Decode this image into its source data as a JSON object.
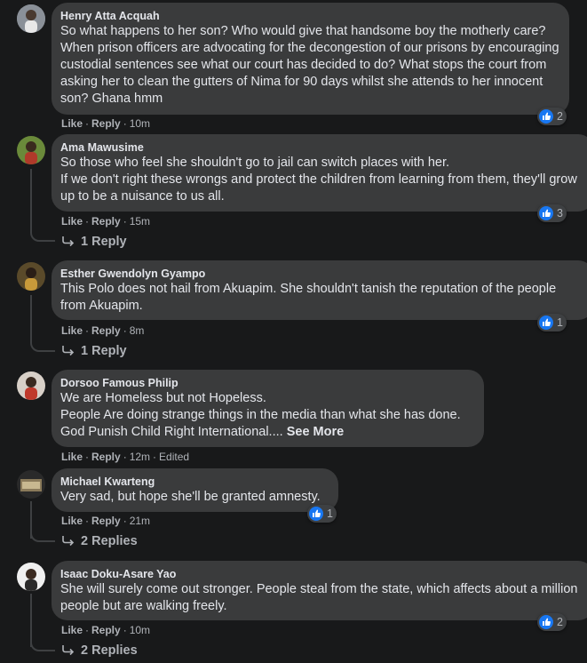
{
  "comments": [
    {
      "author": "Henry Atta Acquah",
      "text": "So what happens to her son? Who would give that handsome boy the motherly care? When prison officers are advocating for the decongestion of our prisons by encouraging custodial sentences see what our court has decided to do? What stops the court from asking her to clean the gutters of Nima for 90 days whilst she attends to her innocent son? Ghana hmm",
      "like": "Like",
      "reply": "Reply",
      "time": "10m",
      "reactions": "2"
    },
    {
      "author": "Ama Mawusime",
      "text": "So those who feel she shouldn't go to jail can switch places with her.\nIf we don't right these wrongs and protect the children from learning from them, they'll grow up to be a nuisance to us all.",
      "like": "Like",
      "reply": "Reply",
      "time": "15m",
      "reactions": "3",
      "replies": "1 Reply"
    },
    {
      "author": "Esther Gwendolyn Gyampo",
      "text": "This Polo does not hail from Akuapim. She shouldn't tanish the reputation of the people from Akuapim.",
      "like": "Like",
      "reply": "Reply",
      "time": "8m",
      "reactions": "1",
      "replies": "1 Reply"
    },
    {
      "author": "Dorsoo Famous Philip",
      "text": "We are Homeless but not Hopeless.\nPeople Are doing strange things in the media than what she has done.\nGod Punish Child Right International....",
      "see_more": "See More",
      "like": "Like",
      "reply": "Reply",
      "time": "12m",
      "edited": "Edited"
    },
    {
      "author": "Michael Kwarteng",
      "text": "Very sad, but hope she'll be granted amnesty.",
      "like": "Like",
      "reply": "Reply",
      "time": "21m",
      "reactions": "1",
      "replies": "2 Replies"
    },
    {
      "author": "Isaac Doku-Asare Yao",
      "text": "She will surely come out stronger. People steal from the state, which affects about a million people but are walking freely.",
      "like": "Like",
      "reply": "Reply",
      "time": "10m",
      "reactions": "2",
      "replies": "2 Replies"
    }
  ],
  "icons": {
    "reaction": "like-thumb-icon",
    "reply_arrow": "reply-arrow-icon"
  },
  "colors": {
    "bubble": "#3a3b3c",
    "background": "#18191a",
    "like_blue": "#1877f2",
    "muted": "#b0b3b8"
  }
}
